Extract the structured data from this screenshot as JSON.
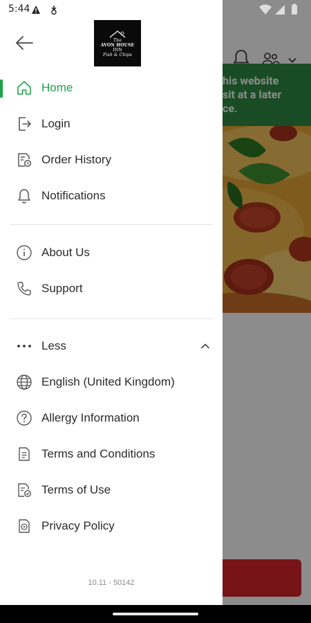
{
  "status_bar": {
    "time": "5:44"
  },
  "background": {
    "banner_text": "his website\nsit at a later\nce.",
    "brand_color": "#2e8a43",
    "order_button_color": "#d8262b"
  },
  "drawer": {
    "logo_text": [
      "The",
      "AVON HOUSE",
      "INN",
      "Fish & Chips"
    ],
    "menu_primary": [
      {
        "label": "Home",
        "icon": "home-icon",
        "active": true
      },
      {
        "label": "Login",
        "icon": "login-icon",
        "active": false
      },
      {
        "label": "Order History",
        "icon": "receipt-clock-icon",
        "active": false
      },
      {
        "label": "Notifications",
        "icon": "bell-icon",
        "active": false
      }
    ],
    "menu_secondary": [
      {
        "label": "About Us",
        "icon": "info-icon"
      },
      {
        "label": "Support",
        "icon": "phone-icon"
      }
    ],
    "less_label": "Less",
    "menu_more": [
      {
        "label": "English (United Kingdom)",
        "icon": "globe-icon"
      },
      {
        "label": "Allergy Information",
        "icon": "question-icon"
      },
      {
        "label": "Terms and Conditions",
        "icon": "document-icon"
      },
      {
        "label": "Terms of Use",
        "icon": "document-check-icon"
      },
      {
        "label": "Privacy Policy",
        "icon": "privacy-icon"
      }
    ],
    "version": "10.11 - 50142",
    "accent_color": "#1fa34a"
  }
}
